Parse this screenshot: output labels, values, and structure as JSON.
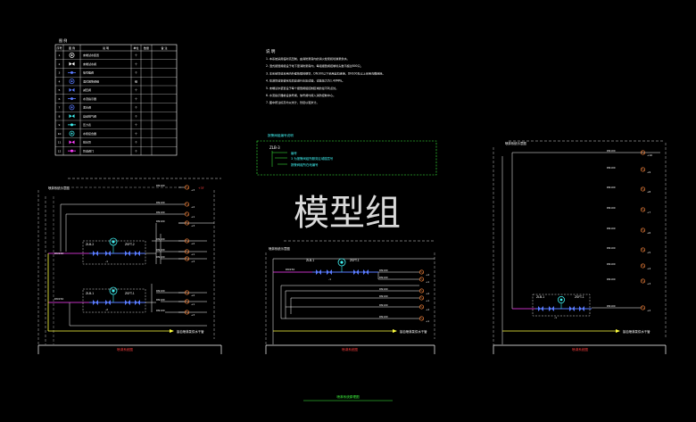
{
  "watermark": "模型组",
  "legend": {
    "title": "图 例",
    "headers": [
      "序号",
      "图 例",
      "说 明",
      "单位",
      "数量",
      "备 注"
    ],
    "rows": [
      {
        "no": "1",
        "label": "末端试水装置",
        "unit": "个",
        "icon": "valve-icon",
        "color": "#ffffff"
      },
      {
        "no": "2",
        "label": "末端试水阀",
        "unit": "个",
        "icon": "valve-icon",
        "color": "#ffffff"
      },
      {
        "no": "3",
        "label": "信号蝶阀",
        "unit": "个",
        "icon": "butterfly-valve-icon",
        "color": "#5a7bff"
      },
      {
        "no": "4",
        "label": "湿式报警阀组",
        "unit": "组",
        "icon": "alarm-valve-icon",
        "color": "#5a7bff"
      },
      {
        "no": "5",
        "label": "减压阀",
        "unit": "个",
        "icon": "reducer-icon",
        "color": "#5a7bff"
      },
      {
        "no": "6",
        "label": "水流指示器",
        "unit": "个",
        "icon": "flow-indicator-icon",
        "color": "#5a7bff"
      },
      {
        "no": "7",
        "label": "泄水阀",
        "unit": "个",
        "icon": "drain-icon",
        "color": "#5a7bff"
      },
      {
        "no": "8",
        "label": "自动排气阀",
        "unit": "个",
        "icon": "vent-icon",
        "color": "#3ff0f0"
      },
      {
        "no": "9",
        "label": "压力表",
        "unit": "个",
        "icon": "gauge-icon",
        "color": "#3ff0f0"
      },
      {
        "no": "10",
        "label": "水泵接合器",
        "unit": "个",
        "icon": "connector-icon",
        "color": "#3ff0f0"
      },
      {
        "no": "11",
        "label": "排水管",
        "unit": "个",
        "icon": "pipe-icon",
        "color": "#ff3fff"
      },
      {
        "no": "12",
        "label": "管道阀门",
        "unit": "个",
        "icon": "gate-valve-icon",
        "color": "#ff3fff"
      }
    ]
  },
  "notes": {
    "title": "说 明",
    "lines": [
      "1. 本系统采用临时高压制，由消防泵房内的消火栓泵和喷淋泵供水。",
      "2. 湿式报警阀组设于地下室消防泵房内，每组报警阀控制喷头数不超过800只。",
      "3. 本系统管道采用内外壁热镀锌钢管，DN100以下采用丝扣连接，DN100及以上采用沟槽连接。",
      "4. 喷淋管道安装完毕后应进行水压试验，试验压力为1.40MPa。",
      "5. 末端试水装置设于每个报警阀组控制区域的最不利点处。",
      "6. 水流指示器前设信号阀，信号阀均接入消防控制中心。",
      "7. 图中所注标高均以米计，管径以毫米计。"
    ]
  },
  "key_box": {
    "title": "报警阀组编号说明",
    "code": "ZLB-3",
    "lines": [
      "编号",
      "3 为报警阀组所服务区域楼层号",
      "报警阀组所在地编号"
    ]
  },
  "diagrams": {
    "left": {
      "header": "喷淋系统示意图",
      "valves": [
        "ZLB-2",
        "ZLB-1"
      ],
      "tags": [
        "ZSFT-2",
        "ZSFT-1"
      ],
      "inlet": "DN150",
      "inlet_bottom": "DN150",
      "branch": "DN100",
      "supply_text": "接自喷淋泵供水干管",
      "floors": [
        "+3",
        "+2",
        "+1"
      ],
      "top_label": "+3F",
      "marks": [
        "-1",
        "-2"
      ],
      "title": "喷淋系统图"
    },
    "middle": {
      "header": "喷淋系统示意图",
      "valve": "ZLB-1",
      "tag": "ZSFT-1",
      "inlet": "DN150",
      "branch": "DN100",
      "supply_text": "接自喷淋泵供水干管",
      "floors": [
        "+2",
        "+1"
      ],
      "mark": "-1",
      "title": "喷淋系统图"
    },
    "right": {
      "header": "喷淋系统示意图",
      "valve": "ZLB-1",
      "tag": "ZSFT-1",
      "branch": "DN100",
      "supply_text": "接自喷淋泵供水干管",
      "floors": [
        "+10",
        "+9",
        "+8",
        "+7",
        "+6",
        "+5",
        "+4",
        "+3",
        "+2",
        "+1"
      ],
      "mark": "-1",
      "title": "喷淋系统图"
    }
  },
  "page_caption": "喷淋系统原理图"
}
